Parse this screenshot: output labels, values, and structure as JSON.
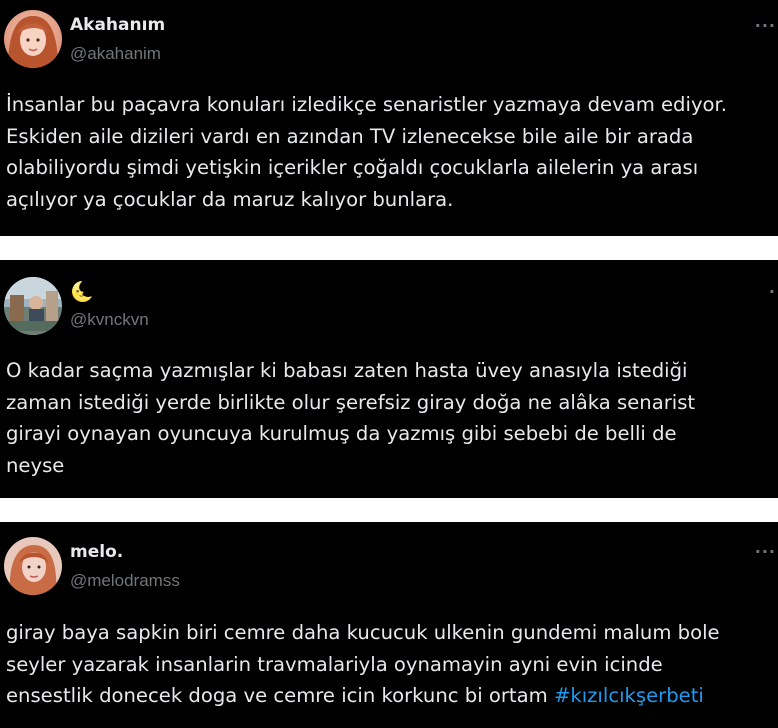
{
  "tweets": [
    {
      "display_name": "Akahanım",
      "handle": "@akahanim",
      "more_label": "···",
      "lines": [
        "İnsanlar bu paçavra konuları izledikçe senaristler yazmaya devam ediyor.",
        "Eskiden aile dizileri vardı en azından TV izlenecekse bile aile bir arada",
        "olabiliyordu şimdi yetişkin içerikler çoğaldı çocuklarla ailelerin ya arası",
        "açılıyor ya çocuklar da maruz kalıyor bunlara."
      ]
    },
    {
      "display_name": "🌜",
      "handle": "@kvnckvn",
      "more_label": "·",
      "lines": [
        "O kadar saçma yazmışlar ki babası zaten hasta üvey anasıyla istediği",
        "zaman istediği yerde birlikte  olur şerefsiz giray doğa ne alâka senarist",
        "girayi oynayan oyuncuya kurulmuş da yazmış gibi sebebi de belli de",
        "neyse"
      ]
    },
    {
      "display_name": "melo.",
      "handle": "@melodramss",
      "more_label": "···",
      "lines": [
        "giray baya sapkin biri cemre daha kucucuk ulkenin gundemi malum bole",
        "seyler yazarak insanlarin travmalariyla oynamayin ayni evin icinde",
        "ensestlik donecek doga ve cemre icin korkunc bi ortam"
      ],
      "hashtag": "#kızılcıkşerbeti"
    }
  ],
  "colors": {
    "background": "#000000",
    "text": "#e7e9ea",
    "secondary": "#71767b",
    "accent": "#1d9bf0",
    "separator": "#ffffff"
  }
}
